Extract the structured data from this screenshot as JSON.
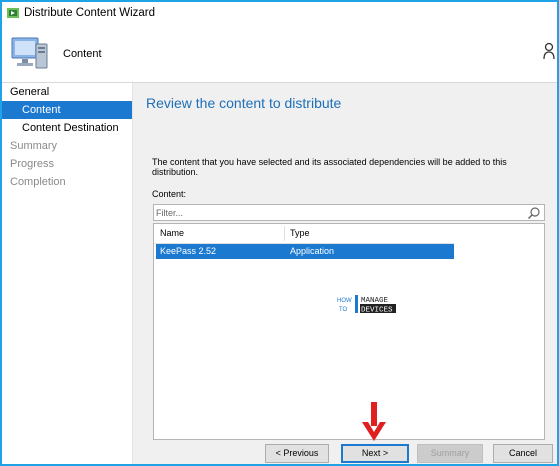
{
  "window": {
    "title": "Distribute Content Wizard"
  },
  "header": {
    "title": "Content"
  },
  "sidebar": {
    "items": [
      {
        "label": "General",
        "level": 0,
        "state": "group"
      },
      {
        "label": "Content",
        "level": 1,
        "state": "selected"
      },
      {
        "label": "Content Destination",
        "level": 1,
        "state": "normal"
      },
      {
        "label": "Summary",
        "level": 0,
        "state": "pending"
      },
      {
        "label": "Progress",
        "level": 0,
        "state": "pending"
      },
      {
        "label": "Completion",
        "level": 0,
        "state": "pending"
      }
    ]
  },
  "main": {
    "title": "Review the content to distribute",
    "description": "The content that you have selected and its associated dependencies will be added to this distribution.",
    "content_label": "Content:",
    "filter_placeholder": "Filter...",
    "columns": [
      "Name",
      "Type"
    ],
    "rows": [
      {
        "name": "KeePass 2.52",
        "type": "Application",
        "selected": true
      }
    ],
    "watermark": {
      "line1": "HOW",
      "line2": "TO",
      "word1": "MANAGE",
      "word2": "DEVICES"
    }
  },
  "buttons": {
    "previous": "< Previous",
    "next": "Next >",
    "summary": "Summary",
    "cancel": "Cancel"
  },
  "colors": {
    "accent": "#1c79d0",
    "title_blue": "#1e6fb8",
    "border_cyan": "#1fa3e6",
    "arrow_red": "#e02020"
  },
  "icons": [
    "wizard-icon",
    "computer-icon",
    "user-icon",
    "search-icon",
    "red-arrow-icon"
  ]
}
